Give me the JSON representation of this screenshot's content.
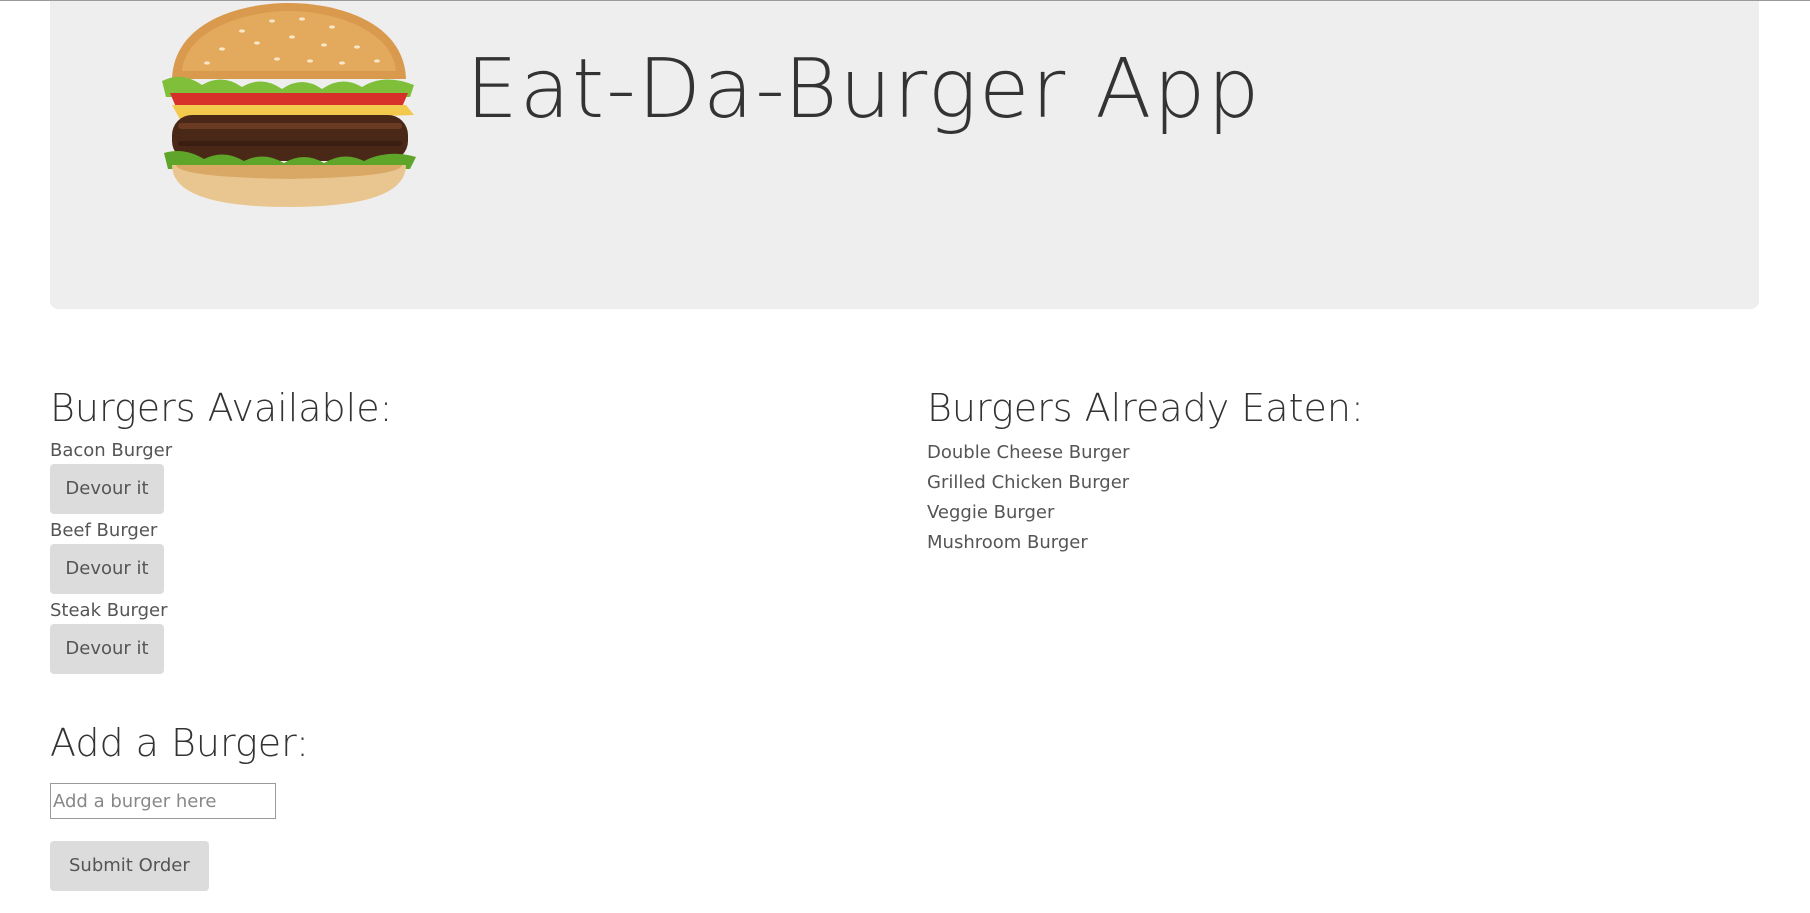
{
  "header": {
    "title": "Eat-Da-Burger App",
    "logo_icon": "burger-icon"
  },
  "available": {
    "heading": "Burgers Available:",
    "items": [
      {
        "name": "Bacon Burger",
        "button": "Devour it"
      },
      {
        "name": "Beef Burger",
        "button": "Devour it"
      },
      {
        "name": "Steak Burger",
        "button": "Devour it"
      }
    ]
  },
  "eaten": {
    "heading": "Burgers Already Eaten:",
    "items": [
      "Double Cheese Burger",
      "Grilled Chicken Burger",
      "Veggie Burger",
      "Mushroom Burger"
    ]
  },
  "add": {
    "heading": "Add a Burger:",
    "placeholder": "Add a burger here",
    "value": "",
    "submit_label": "Submit Order"
  },
  "colors": {
    "jumbotron_bg": "#eeeeee",
    "button_bg": "#dcdcdc",
    "text": "#333333"
  }
}
